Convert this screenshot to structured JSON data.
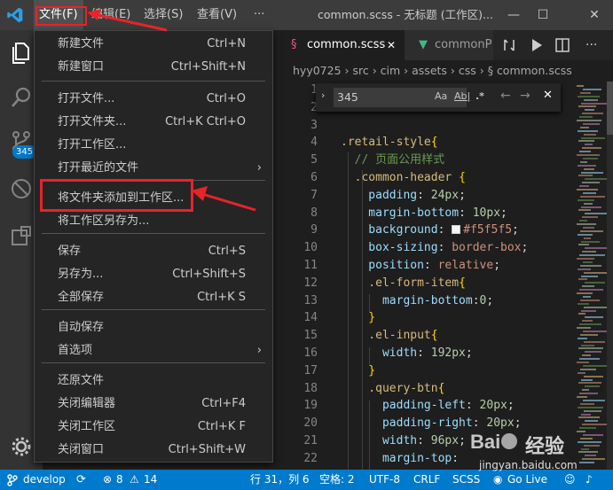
{
  "titlebar": {
    "menus": [
      "文件(F)",
      "编辑(E)",
      "选择(S)",
      "查看(V)",
      "···"
    ],
    "title": "common.scss - 无标题 (工作区)...",
    "minimize": "—",
    "maximize": "☐",
    "close": "✕"
  },
  "activitybar": {
    "scm_badge": "345",
    "explorer_badge": "1"
  },
  "file_menu": {
    "items": [
      {
        "label": "新建文件",
        "shortcut": "Ctrl+N"
      },
      {
        "label": "新建窗口",
        "shortcut": "Ctrl+Shift+N"
      },
      {
        "label": "打开文件...",
        "shortcut": "Ctrl+O"
      },
      {
        "label": "打开文件夹...",
        "shortcut": "Ctrl+K Ctrl+O"
      },
      {
        "label": "打开工作区...",
        "shortcut": ""
      },
      {
        "label": "打开最近的文件",
        "shortcut": ""
      },
      {
        "label": "将文件夹添加到工作区...",
        "shortcut": ""
      },
      {
        "label": "将工作区另存为...",
        "shortcut": ""
      },
      {
        "label": "保存",
        "shortcut": "Ctrl+S"
      },
      {
        "label": "另存为...",
        "shortcut": "Ctrl+Shift+S"
      },
      {
        "label": "全部保存",
        "shortcut": "Ctrl+K S"
      },
      {
        "label": "自动保存",
        "shortcut": ""
      },
      {
        "label": "首选项",
        "shortcut": ""
      },
      {
        "label": "还原文件",
        "shortcut": ""
      },
      {
        "label": "关闭编辑器",
        "shortcut": "Ctrl+F4"
      },
      {
        "label": "关闭工作区",
        "shortcut": "Ctrl+K F"
      },
      {
        "label": "关闭窗口",
        "shortcut": "Ctrl+Shift+W"
      }
    ]
  },
  "tabs": [
    {
      "label": "common.scss",
      "close": "✕",
      "active": true
    },
    {
      "label": "commonP",
      "active": false
    }
  ],
  "breadcrumb": "hyy0725 › src › cim › assets › css › § common.scss",
  "find": {
    "value": "345",
    "match_case": "Aa",
    "whole_word": "Ab|",
    "regex": ".*",
    "prev": "←",
    "next": "→",
    "close": "✕"
  },
  "editor": {
    "line_numbers": [
      "1",
      "2",
      "3",
      "4",
      "5",
      "6",
      "7",
      "8",
      "9",
      "10",
      "11",
      "12",
      "13",
      "14",
      "15",
      "16",
      "17",
      "18",
      "19",
      "20",
      "21",
      "22"
    ],
    "lines": [
      "",
      "",
      "",
      ".retail-style{",
      "  // 页面公用样式",
      "  .common-header {",
      "    padding: 24px;",
      "    margin-bottom: 10px;",
      "    background: #f5f5f5;",
      "    box-sizing: border-box;",
      "    position: relative;",
      "    .el-form-item{",
      "      margin-bottom:0;",
      "    }",
      "    .el-input{",
      "      width: 192px;",
      "    }",
      "    .query-btn{",
      "      padding-left: 20px;",
      "      padding-right: 20px;",
      "      width: 96px;",
      "      margin-top:"
    ]
  },
  "statusbar": {
    "branch": "develop",
    "errors": "8",
    "warnings": "14",
    "position": "行 31，列 6",
    "spaces": "空格: 2",
    "encoding": "UTF-8",
    "eol": "CRLF",
    "language": "SCSS",
    "golive": "Go Live"
  },
  "watermark": {
    "brand": "Baidu",
    "suffix": "经验",
    "url": "jingyan.baidu.com"
  },
  "colors": {
    "accent": "#007acc",
    "annotation": "#e8232a",
    "menu_bg": "#252526",
    "editor_bg": "#1e1e1e"
  }
}
